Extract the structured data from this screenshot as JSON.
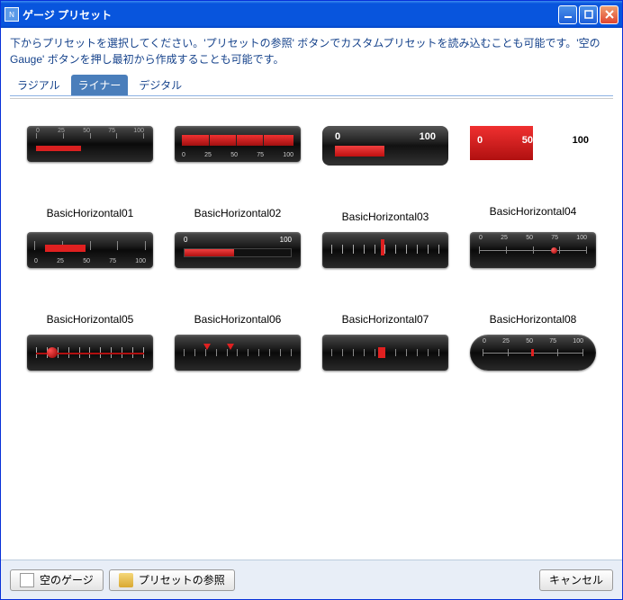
{
  "window": {
    "title": "ゲージ プリセット"
  },
  "instruction": "下からプリセットを選択してください。'プリセットの参照' ボタンでカスタムプリセットを読み込むことも可能です。'空の Gauge' ボタンを押し最初から作成することも可能です。",
  "tabs": {
    "radial": "ラジアル",
    "linear": "ライナー",
    "digital": "デジタル"
  },
  "presets": [
    {
      "label": "BasicHorizontal01",
      "ticks": [
        "0",
        "25",
        "50",
        "75",
        "100"
      ]
    },
    {
      "label": "BasicHorizontal02",
      "ticks": [
        "0",
        "25",
        "50",
        "75",
        "100"
      ]
    },
    {
      "label": "BasicHorizontal03",
      "ticks": [
        "0",
        "100"
      ]
    },
    {
      "label": "BasicHorizontal04",
      "ticks": [
        "0",
        "50",
        "100"
      ]
    },
    {
      "label": "BasicHorizontal05",
      "ticks": [
        "0",
        "25",
        "50",
        "75",
        "100"
      ]
    },
    {
      "label": "BasicHorizontal06",
      "ticks": [
        "0",
        "100"
      ]
    },
    {
      "label": "BasicHorizontal07",
      "ticks": []
    },
    {
      "label": "BasicHorizontal08",
      "ticks": [
        "0",
        "25",
        "50",
        "75",
        "100"
      ]
    },
    {
      "label": "",
      "ticks": []
    },
    {
      "label": "",
      "ticks": []
    },
    {
      "label": "",
      "ticks": []
    },
    {
      "label": "",
      "ticks": [
        "0",
        "25",
        "50",
        "75",
        "100"
      ]
    }
  ],
  "footer": {
    "empty_gauge": "空のゲージ",
    "browse_presets": "プリセットの参照",
    "cancel": "キャンセル"
  }
}
